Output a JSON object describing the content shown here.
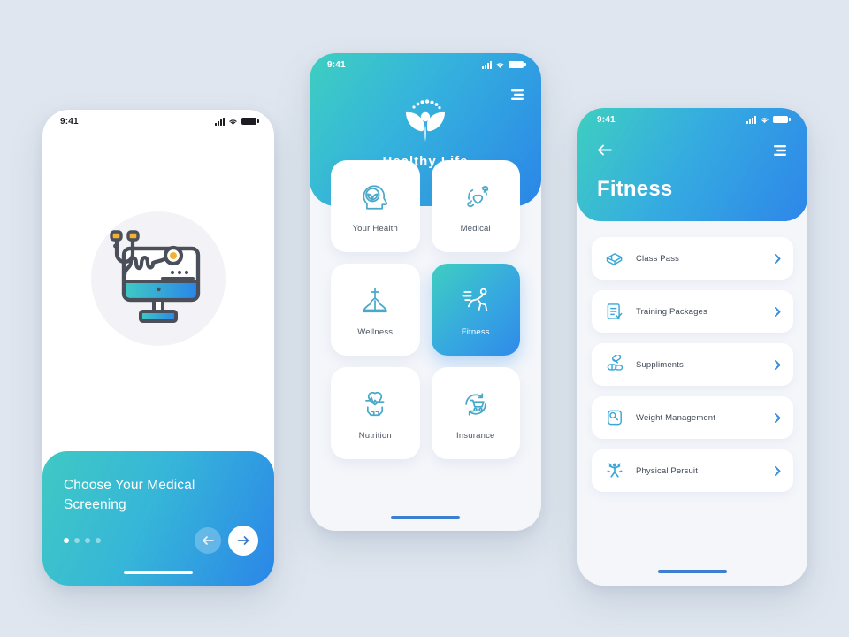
{
  "canvas": {
    "background": "#dfe6ef"
  },
  "palette": {
    "teal": "#3ecfc0",
    "cyan": "#35b4dc",
    "blue": "#2b86e8",
    "icon_blue": "#3ba7d8",
    "text_dark": "#3f4854",
    "card_bg": "#ffffff",
    "screen_bg": "#f4f6fa"
  },
  "phone1": {
    "status": {
      "time": "9:41",
      "signal_icon": "signal-bars-icon",
      "wifi_icon": "wifi-icon",
      "battery_icon": "battery-icon"
    },
    "illustration": {
      "name": "medical-monitor-stethoscope-illustration"
    },
    "card": {
      "title": "Choose Your Medical Screening",
      "dots_total": 4,
      "dots_active_index": 0,
      "prev_label": "←",
      "next_label": "→"
    }
  },
  "phone2": {
    "status": {
      "time": "9:41",
      "signal_icon": "signal-bars-icon",
      "wifi_icon": "wifi-icon",
      "battery_icon": "battery-icon"
    },
    "menu_icon": "hamburger-menu-icon",
    "brand": {
      "name": "Healthy Life",
      "logo_icon": "leaf-person-logo-icon"
    },
    "tiles": [
      {
        "label": "Your Health",
        "icon": "head-leaf-icon",
        "active": false
      },
      {
        "label": "Medical",
        "icon": "hands-heart-icon",
        "active": false
      },
      {
        "label": "Wellness",
        "icon": "yoga-pose-icon",
        "active": false
      },
      {
        "label": "Fitness",
        "icon": "running-person-icon",
        "active": true
      },
      {
        "label": "Nutrition",
        "icon": "hands-heart-pulse-icon",
        "active": false
      },
      {
        "label": "Insurance",
        "icon": "cart-refresh-icon",
        "active": false
      }
    ]
  },
  "phone3": {
    "status": {
      "time": "9:41",
      "signal_icon": "signal-bars-icon",
      "wifi_icon": "wifi-icon",
      "battery_icon": "battery-icon"
    },
    "back_icon": "back-arrow-icon",
    "menu_icon": "hamburger-menu-icon",
    "title": "Fitness",
    "rows": [
      {
        "label": "Class Pass",
        "icon": "ticket-icon"
      },
      {
        "label": "Training Packages",
        "icon": "checklist-icon"
      },
      {
        "label": "Suppliments",
        "icon": "pills-icon"
      },
      {
        "label": "Weight Management",
        "icon": "weight-scale-icon"
      },
      {
        "label": "Physical Persuit",
        "icon": "jumping-person-icon"
      }
    ]
  }
}
